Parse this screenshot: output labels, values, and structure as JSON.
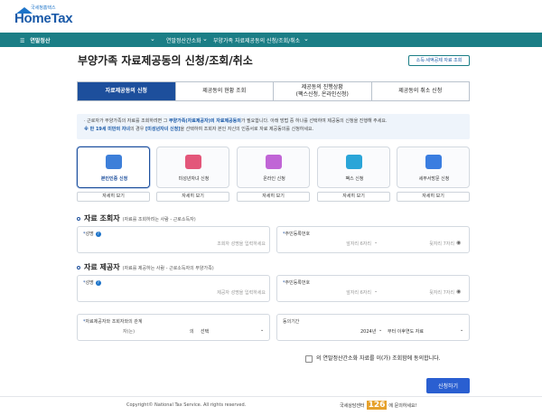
{
  "header": {
    "logo_small": "국세청홈택스",
    "logo": "HomeTax"
  },
  "nav": {
    "menu": "연말정산",
    "items": [
      "연말정산간소화",
      "부양가족 자료제공동의 신청/조회/취소"
    ]
  },
  "page": {
    "title": "부양가족 자료제공동의 신청/조회/취소",
    "side_link": "소득·세액공제 자료 조회"
  },
  "tabs": [
    {
      "label": "자료제공동의 신청",
      "active": true
    },
    {
      "label": "제공동의 현황 조회",
      "active": false
    },
    {
      "label": "제공동의 진행상황\n(팩스신청, 온라인신청)",
      "active": false
    },
    {
      "label": "제공동의 취소 신청",
      "active": false
    }
  ],
  "notice": {
    "line1_pre": "· 근로자가 부양가족의 자료를 조회하려면 그 ",
    "line1_hl": "부양가족(자료제공자)의 자료제공동의",
    "line1_post": "가 필요합니다. 아래 방법 중 하나를 선택하여 제공동의 신청을 진행해 주세요.",
    "line2_hl": "※ 만 19세 미만의 자녀",
    "line2_mid": "의 경우 ",
    "line2_hl2": "[미성년자녀 신청]",
    "line2_post": "을 선택하여 조회자 본인 자신의 인증서로 자료 제공동의를 신청하세요."
  },
  "methods": [
    {
      "label": "본인인증 신청",
      "more": "자세히 보기",
      "active": true,
      "icon": "id-card-icon",
      "color": "#3d7fd9"
    },
    {
      "label": "미성년자녀 신청",
      "more": "자세히 보기",
      "active": false,
      "icon": "child-doc-icon",
      "color": "#e3567a"
    },
    {
      "label": "온라인 신청",
      "more": "자세히 보기",
      "active": false,
      "icon": "monitor-icon",
      "color": "#c065d6"
    },
    {
      "label": "팩스 신청",
      "more": "자세히 보기",
      "active": false,
      "icon": "fax-icon",
      "color": "#2aa5d8"
    },
    {
      "label": "세무서방문 신청",
      "more": "자세히 보기",
      "active": false,
      "icon": "building-icon",
      "color": "#3a7de0"
    }
  ],
  "viewer": {
    "title": "자료 조회자",
    "subtitle": "(자료를 조회하려는 사람 - 근로소득자)",
    "name_label": "성명",
    "name_placeholder": "조회자 성명을 입력하세요",
    "rrn_label": "주민등록번호",
    "rrn_front_placeholder": "앞자리 6자리",
    "rrn_back_placeholder": "뒷자리 7자리"
  },
  "provider": {
    "title": "자료 제공자",
    "subtitle": "(자료를 제공하는 사람 - 근로소득자의 부양가족)",
    "name_label": "성명",
    "name_placeholder": "제공자 성명을 입력하세요",
    "rrn_label": "주민등록번호",
    "rrn_front_placeholder": "앞자리 6자리",
    "rrn_back_placeholder": "뒷자리 7자리",
    "relation_label": "자료제공자와 조회자와의 관계",
    "relation_prefix": "자(는)",
    "relation_mid": "의",
    "relation_value": "선택",
    "period_label": "동의기간",
    "period_year": "2024년",
    "period_value": "부터 이후연도 자료"
  },
  "agree": {
    "text": "의 연말정산간소화 자료를 이(가) 조회함에 동의합니다."
  },
  "submit": "신청하기",
  "footer": {
    "copyright": "Copyright© National Tax Service. All rights reserved.",
    "call_pre": "국세상담센터",
    "call_num": "126",
    "call_post": "에 문의하세요!"
  }
}
